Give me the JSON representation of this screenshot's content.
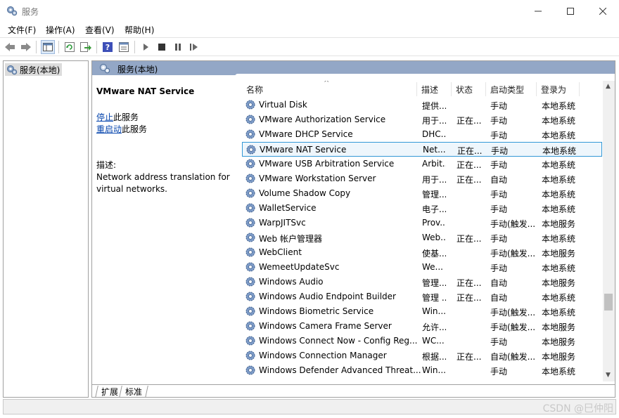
{
  "window": {
    "title": "服务"
  },
  "menu": [
    "文件(F)",
    "操作(A)",
    "查看(V)",
    "帮助(H)"
  ],
  "tree": {
    "root_label": "服务(本地)"
  },
  "pane": {
    "header_title": "服务(本地)"
  },
  "detail": {
    "title": "VMware NAT Service",
    "stop_link": "停止",
    "stop_suffix": "此服务",
    "restart_link": "重启动",
    "restart_suffix": "此服务",
    "desc_label": "描述:",
    "desc_line1": "Network address translation for",
    "desc_line2": "virtual networks."
  },
  "columns": {
    "name": "名称",
    "desc": "描述",
    "status": "状态",
    "startup": "启动类型",
    "logon": "登录为"
  },
  "services": [
    {
      "name": "Virtual Disk",
      "desc": "提供...",
      "status": "",
      "startup": "手动",
      "logon": "本地系统"
    },
    {
      "name": "VMware Authorization Service",
      "desc": "用于...",
      "status": "正在...",
      "startup": "手动",
      "logon": "本地系统"
    },
    {
      "name": "VMware DHCP Service",
      "desc": "DHC...",
      "status": "",
      "startup": "手动",
      "logon": "本地系统"
    },
    {
      "name": "VMware NAT Service",
      "desc": "Net...",
      "status": "正在...",
      "startup": "手动",
      "logon": "本地系统"
    },
    {
      "name": "VMware USB Arbitration Service",
      "desc": "Arbit...",
      "status": "正在...",
      "startup": "手动",
      "logon": "本地系统"
    },
    {
      "name": "VMware Workstation Server",
      "desc": "用于...",
      "status": "正在...",
      "startup": "自动",
      "logon": "本地系统"
    },
    {
      "name": "Volume Shadow Copy",
      "desc": "管理...",
      "status": "",
      "startup": "手动",
      "logon": "本地系统"
    },
    {
      "name": "WalletService",
      "desc": "电子...",
      "status": "",
      "startup": "手动",
      "logon": "本地系统"
    },
    {
      "name": "WarpJITSvc",
      "desc": "Prov...",
      "status": "",
      "startup": "手动(触发...",
      "logon": "本地服务"
    },
    {
      "name": "Web 帐户管理器",
      "desc": "Web...",
      "status": "正在...",
      "startup": "手动",
      "logon": "本地系统"
    },
    {
      "name": "WebClient",
      "desc": "使基...",
      "status": "",
      "startup": "手动(触发...",
      "logon": "本地服务"
    },
    {
      "name": "WemeetUpdateSvc",
      "desc": "We...",
      "status": "",
      "startup": "手动",
      "logon": "本地系统"
    },
    {
      "name": "Windows Audio",
      "desc": "管理...",
      "status": "正在...",
      "startup": "自动",
      "logon": "本地服务"
    },
    {
      "name": "Windows Audio Endpoint Builder",
      "desc": "管理 ...",
      "status": "正在...",
      "startup": "自动",
      "logon": "本地系统"
    },
    {
      "name": "Windows Biometric Service",
      "desc": "Win...",
      "status": "",
      "startup": "手动(触发...",
      "logon": "本地系统"
    },
    {
      "name": "Windows Camera Frame Server",
      "desc": "允许...",
      "status": "",
      "startup": "手动(触发...",
      "logon": "本地服务"
    },
    {
      "name": "Windows Connect Now - Config Reg...",
      "desc": "WC...",
      "status": "",
      "startup": "手动",
      "logon": "本地服务"
    },
    {
      "name": "Windows Connection Manager",
      "desc": "根据...",
      "status": "正在...",
      "startup": "自动(触发...",
      "logon": "本地服务"
    },
    {
      "name": "Windows Defender Advanced Threat...",
      "desc": "Win...",
      "status": "",
      "startup": "手动",
      "logon": "本地系统"
    }
  ],
  "selected_index": 3,
  "tabs": [
    "扩展",
    "标准"
  ],
  "watermark": "CSDN @巳仲阳",
  "colors": {
    "header_bg": "#93a7c6",
    "selection_border": "#3398d6",
    "link": "#0645ad"
  }
}
